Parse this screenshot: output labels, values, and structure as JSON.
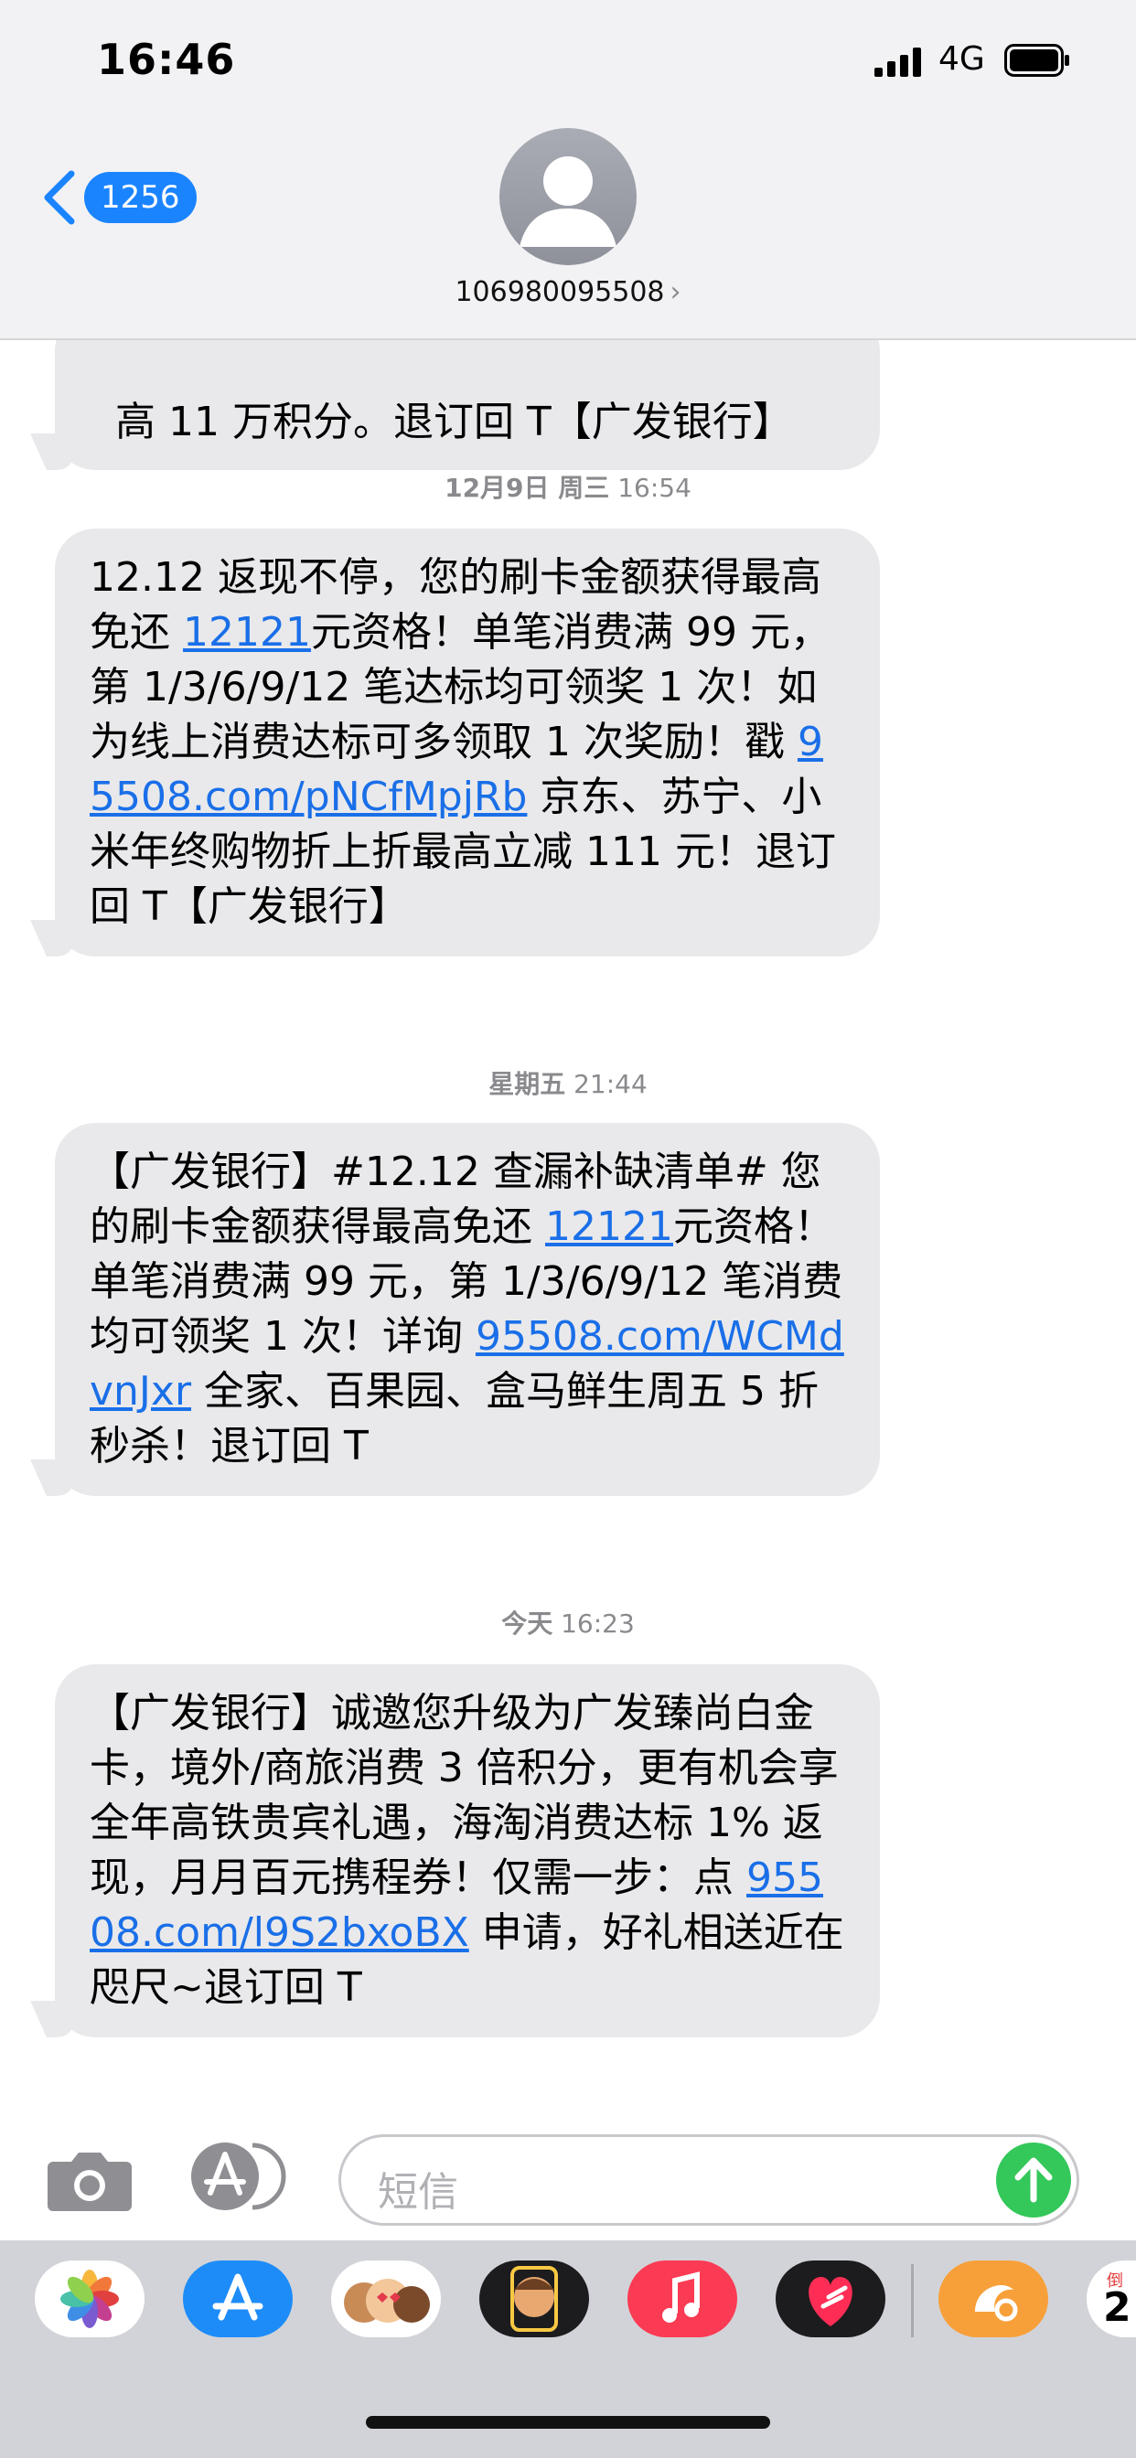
{
  "status_bar": {
    "time": "16:46",
    "network": "4G"
  },
  "nav": {
    "back_count": "1256",
    "contact": "106980095508",
    "contact_chevron": "›"
  },
  "messages": [
    {
      "text": "高 11 万积分。退订回 T【广发银行】"
    },
    {
      "timestamp_day": "12月9日 周三",
      "timestamp_time": "16:54",
      "p1": "12.12 返现不停，您的刷卡金额获得最高免还 ",
      "l1": "12121",
      "p2": "元资格！单笔消费满 99 元，第 1/3/6/9/12 笔达标均可领奖 1 次！如为线上消费达标可多领取 1 次奖励！戳 ",
      "l2": "95508.com/pNCfMpjRb",
      "p3": " 京东、苏宁、小米年终购物折上折最高立减 111 元！退订回 T【广发银行】"
    },
    {
      "timestamp_day": "星期五",
      "timestamp_time": "21:44",
      "p1": "【广发银行】#12.12 查漏补缺清单# 您的刷卡金额获得最高免还 ",
      "l1": "12121",
      "p2": "元资格！单笔消费满 99 元，第 1/3/6/9/12 笔消费均可领奖 1 次！详询 ",
      "l2": "95508.com/WCMdvnJxr",
      "p3": " 全家、百果园、盒马鲜生周五 5 折秒杀！退订回 T"
    },
    {
      "timestamp_day": "今天",
      "timestamp_time": "16:23",
      "p1": "【广发银行】诚邀您升级为广发臻尚白金卡，境外/商旅消费 3 倍积分，更有机会享全年高铁贵宾礼遇，海淘消费达标 1% 返现，月月百元携程券！仅需一步：点 ",
      "l1": "95508.com/l9S2bxoBX",
      "p2": " 申请，好礼相送近在咫尺~退订回 T"
    }
  ],
  "composer": {
    "placeholder": "短信"
  },
  "dock": {
    "apps": [
      {
        "name": "Photos",
        "icon": "photos-icon",
        "color": "#ffffff"
      },
      {
        "name": "App Store",
        "icon": "app-store-icon",
        "color": "#1d8cf8"
      },
      {
        "name": "Memoji",
        "icon": "memoji-icon",
        "color": "#ffffff"
      },
      {
        "name": "Animoji",
        "icon": "animoji-icon",
        "color": "#1c1c1e"
      },
      {
        "name": "Music",
        "icon": "music-icon",
        "color": "#fb3a53"
      },
      {
        "name": "Digital Touch",
        "icon": "heart-icon",
        "color": "#1c1c1e"
      },
      {
        "name": "UC Browser",
        "icon": "uc-browser-icon",
        "color": "#f7a03a"
      },
      {
        "name": "Calendar",
        "icon": "calendar-icon",
        "color": "#ffffff"
      }
    ],
    "calendar_label": "倒",
    "calendar_digit": "2"
  },
  "colors": {
    "link": "#1a6fe8",
    "badge": "#1a84ff",
    "bubble": "#e9e9eb",
    "send": "#34c759"
  }
}
